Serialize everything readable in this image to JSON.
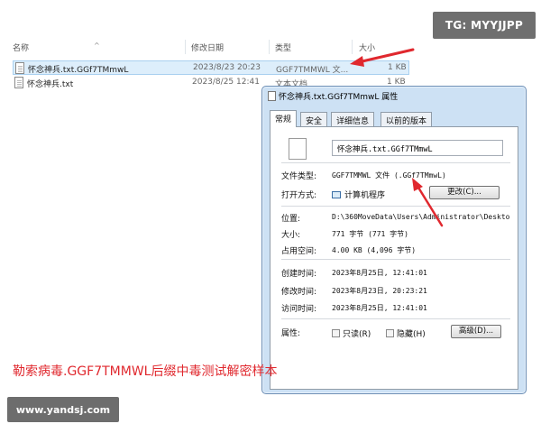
{
  "watermarks": {
    "top": "TG: MYYJJPP",
    "bottom": "www.yandsj.com"
  },
  "columns": {
    "name": "名称",
    "date": "修改日期",
    "type": "类型",
    "size": "大小"
  },
  "files": [
    {
      "name": "怀念神兵.txt.GGf7TMmwL",
      "date": "2023/8/23 20:23",
      "type": "GGF7TMMWL 文...",
      "size": "1 KB",
      "selected": true
    },
    {
      "name": "怀念神兵.txt",
      "date": "2023/8/25 12:41",
      "type": "文本文档",
      "size": "1 KB",
      "selected": false
    }
  ],
  "dialog": {
    "title": "怀念神兵.txt.GGf7TMmwL 属性",
    "tabs": [
      "常规",
      "安全",
      "详细信息",
      "以前的版本"
    ],
    "filename": "怀念神兵.txt.GGf7TMmwL",
    "file_type_label": "文件类型:",
    "file_type_value": "GGF7TMMWL 文件 (.GGf7TMmwL)",
    "open_with_label": "打开方式:",
    "open_with_value": "计算机程序",
    "change_button": "更改(C)...",
    "location_label": "位置:",
    "location_value": "D:\\360MoveData\\Users\\Administrator\\Deskto",
    "size_label": "大小:",
    "size_value": "771 字节 (771 字节)",
    "disk_size_label": "占用空间:",
    "disk_size_value": "4.00 KB (4,096 字节)",
    "created_label": "创建时间:",
    "created_value": "2023年8月25日, 12:41:01",
    "modified_label": "修改时间:",
    "modified_value": "2023年8月23日, 20:23:21",
    "accessed_label": "访问时间:",
    "accessed_value": "2023年8月25日, 12:41:01",
    "attributes_label": "属性:",
    "readonly_label": "只读(R)",
    "hidden_label": "隐藏(H)",
    "advanced_button": "高级(D)..."
  },
  "caption": "勒索病毒.GGF7TMMWL后缀中毒测试解密样本",
  "colors": {
    "annotation": "#e0282e",
    "dialog_frame": "#cde1f4",
    "selection": "#ddeefb"
  }
}
